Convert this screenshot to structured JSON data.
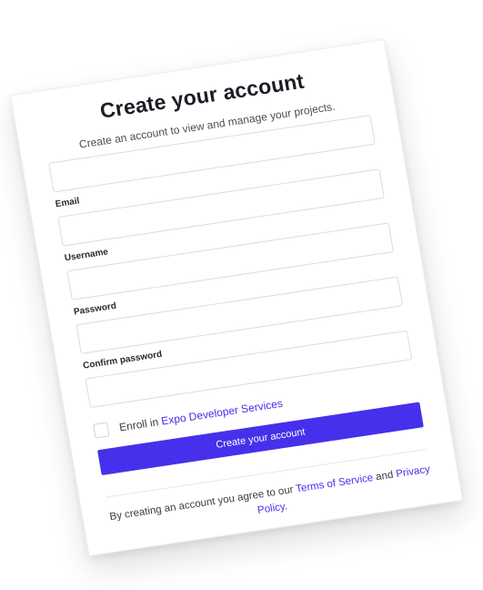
{
  "form": {
    "title": "Create your account",
    "subtitle": "Create an account to view and manage your projects.",
    "fields": [
      {
        "label": "Email",
        "value": "",
        "placeholder": ""
      },
      {
        "label": "Username",
        "value": "",
        "placeholder": ""
      },
      {
        "label": "Password",
        "value": "",
        "placeholder": ""
      },
      {
        "label": "Confirm password",
        "value": "",
        "placeholder": ""
      }
    ],
    "enroll": {
      "prefix": "Enroll in ",
      "link_text": "Expo Developer Services",
      "checked": false
    },
    "submit_label": "Create your account",
    "terms": {
      "prefix": "By creating an account you agree to our ",
      "terms_link": "Terms of Service",
      "middle": " and ",
      "privacy_link": "Privacy Policy",
      "suffix": "."
    }
  },
  "colors": {
    "accent": "#4630eb",
    "text": "#1b1d24",
    "border": "#dadce0"
  }
}
